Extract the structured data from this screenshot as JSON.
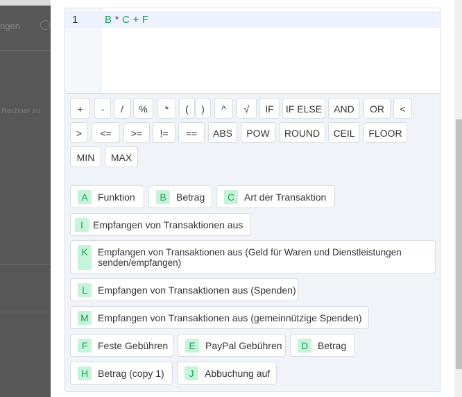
{
  "background": {
    "tab_text": "ngen",
    "sub_text": "Rechner zu"
  },
  "editor": {
    "line_number": "1",
    "tokens": [
      "B",
      "*",
      "C",
      "+",
      "F"
    ]
  },
  "operators": [
    "+",
    "-",
    "/",
    "%",
    "*",
    "(",
    ")",
    "^",
    "√",
    "IF",
    "IF ELSE",
    "AND",
    "OR",
    "<",
    ">",
    "<=",
    ">=",
    "!=",
    "==",
    "ABS",
    "POW",
    "ROUND",
    "CEIL",
    "FLOOR",
    "MIN",
    "MAX"
  ],
  "variables": [
    {
      "key": "A",
      "label": "Funktion"
    },
    {
      "key": "B",
      "label": "Betrag"
    },
    {
      "key": "C",
      "label": "Art der Transaktion"
    },
    {
      "key": "I",
      "label": "Empfangen von Transaktionen aus"
    },
    {
      "key": "K",
      "label": "Empfangen von Transaktionen aus (Geld für Waren und Dienstleistungen senden/empfangen)"
    },
    {
      "key": "L",
      "label": "Empfangen von Transaktionen aus (Spenden)"
    },
    {
      "key": "M",
      "label": "Empfangen von Transaktionen aus (gemeinnützige Spenden)"
    },
    {
      "key": "F",
      "label": "Feste Gebühren"
    },
    {
      "key": "E",
      "label": "PayPal Gebühren"
    },
    {
      "key": "D",
      "label": "Betrag"
    },
    {
      "key": "H",
      "label": "Betrag (copy 1)"
    },
    {
      "key": "J",
      "label": "Abbuchung auf"
    }
  ],
  "colors": {
    "variable_tag_bg": "#c6f3d9",
    "variable_tag_text": "#1aa15a",
    "code_text": "#17a35a"
  }
}
